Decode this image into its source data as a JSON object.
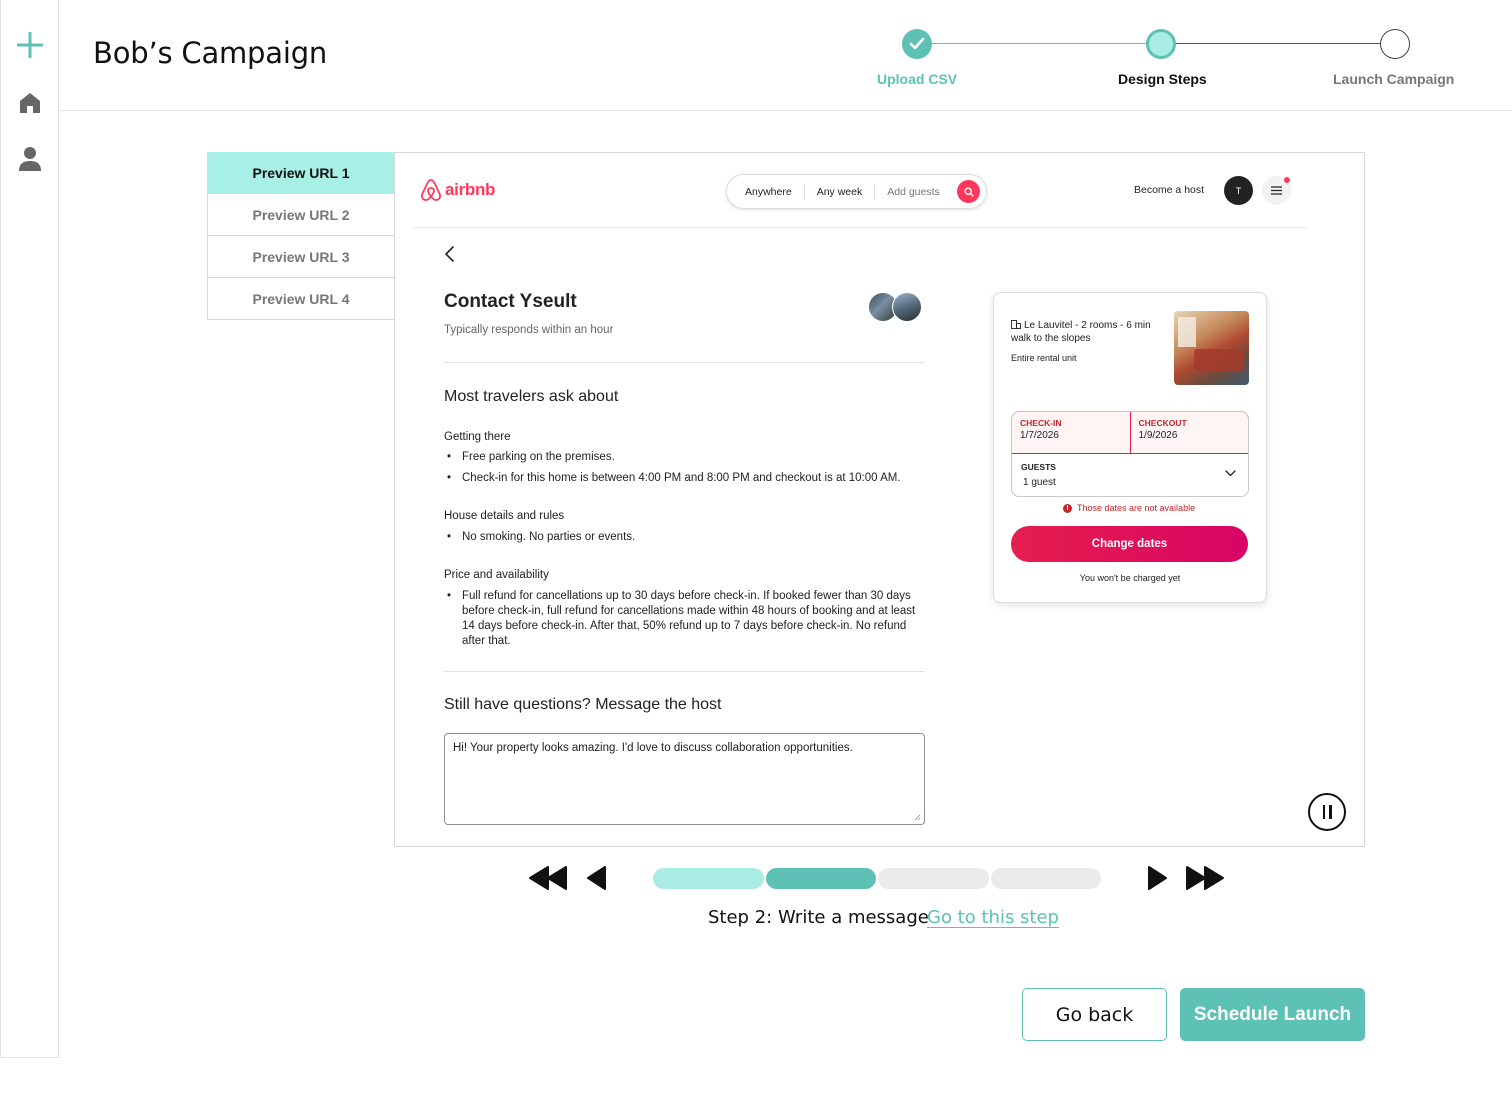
{
  "header": {
    "title": "Bob’s Campaign",
    "steps": [
      {
        "label": "Upload CSV",
        "state": "done"
      },
      {
        "label": "Design Steps",
        "state": "current"
      },
      {
        "label": "Launch Campaign",
        "state": "upcoming"
      }
    ]
  },
  "rail": {
    "icons": [
      "plus-icon",
      "home-icon",
      "user-icon"
    ]
  },
  "preview_tabs": [
    {
      "label": "Preview URL 1",
      "active": true
    },
    {
      "label": "Preview URL 2",
      "active": false
    },
    {
      "label": "Preview URL 3",
      "active": false
    },
    {
      "label": "Preview URL 4",
      "active": false
    }
  ],
  "preview": {
    "logo_text": "airbnb",
    "search": {
      "where": "Anywhere",
      "when": "Any week",
      "who": "Add guests"
    },
    "become_host": "Become a host",
    "avatar_initial": "T",
    "contact_title": "Contact Yseult",
    "responds": "Typically responds within an hour",
    "most_ask_title": "Most travelers ask about",
    "sections": [
      {
        "title": "Getting there",
        "bullets": [
          "Free parking on the premises.",
          "Check-in for this home is between 4:00 PM and 8:00 PM and checkout is at 10:00 AM."
        ]
      },
      {
        "title": "House details and rules",
        "bullets": [
          "No smoking. No parties or events."
        ]
      },
      {
        "title": "Price and availability",
        "bullets": [
          "Full refund for cancellations up to 30 days before check-in. If booked fewer than 30 days before check-in, full refund for cancellations made within 48 hours of booking and at least 14 days before check-in. After that, 50% refund up to 7 days before check-in. No refund after that."
        ]
      }
    ],
    "still_questions": "Still have questions? Message the host",
    "message": "Hi! Your property looks amazing. I'd love to discuss collaboration opportunities.",
    "card": {
      "listing": "Le Lauvitel - 2 rooms - 6 min walk to the slopes",
      "type": "Entire rental unit",
      "checkin_label": "CHECK-IN",
      "checkin": "1/7/2026",
      "checkout_label": "CHECKOUT",
      "checkout": "1/9/2026",
      "guests_label": "GUESTS",
      "guests": "1 guest",
      "error": "Those dates are not available",
      "button": "Change dates",
      "note": "You won't be charged yet"
    }
  },
  "player": {
    "progress_segments": [
      {
        "state": "done"
      },
      {
        "state": "current"
      },
      {
        "state": "upcoming"
      },
      {
        "state": "upcoming"
      }
    ],
    "step_text": "Step 2: Write a message",
    "step_link": "Go to this step"
  },
  "actions": {
    "back": "Go back",
    "launch": "Schedule Launch"
  },
  "colors": {
    "accent": "#5dc2b5",
    "accent_light": "#a8ece3",
    "airbnb": "#ff385c",
    "error": "#c1272d"
  }
}
